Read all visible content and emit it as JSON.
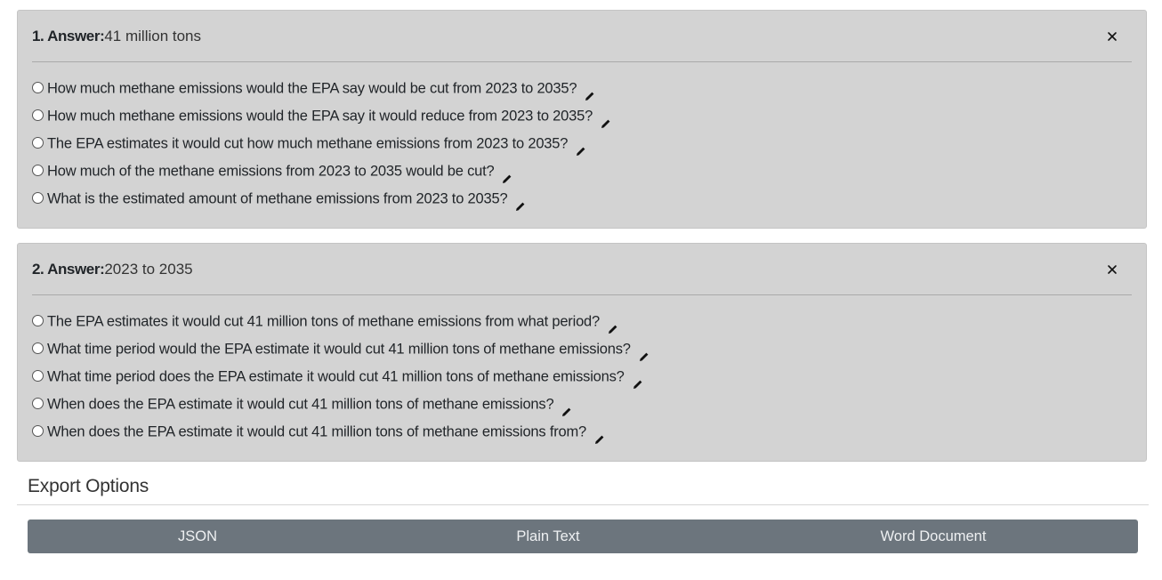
{
  "answers": [
    {
      "number_prefix": "1. Answer:",
      "value": "41 million tons",
      "questions": [
        "How much methane emissions would the EPA say would be cut from 2023 to 2035?",
        "How much methane emissions would the EPA say it would reduce from 2023 to 2035?",
        "The EPA estimates it would cut how much methane emissions from 2023 to 2035?",
        "How much of the methane emissions from 2023 to 2035 would be cut?",
        "What is the estimated amount of methane emissions from 2023 to 2035?"
      ]
    },
    {
      "number_prefix": "2. Answer:",
      "value": "2023 to 2035",
      "questions": [
        "The EPA estimates it would cut 41 million tons of methane emissions from what period?",
        "What time period would the EPA estimate it would cut 41 million tons of methane emissions?",
        "What time period does the EPA estimate it would cut 41 million tons of methane emissions?",
        "When does the EPA estimate it would cut 41 million tons of methane emissions?",
        "When does the EPA estimate it would cut 41 million tons of methane emissions from?"
      ]
    }
  ],
  "icons": {
    "close": "close-icon",
    "edit": "pencil-icon",
    "radio": "radio-button"
  },
  "export": {
    "title": "Export Options",
    "buttons": {
      "json": "JSON",
      "plain_text": "Plain Text",
      "word": "Word Document"
    }
  },
  "colors": {
    "card_background": "#d3d3d3",
    "export_bar": "#6c757d"
  }
}
